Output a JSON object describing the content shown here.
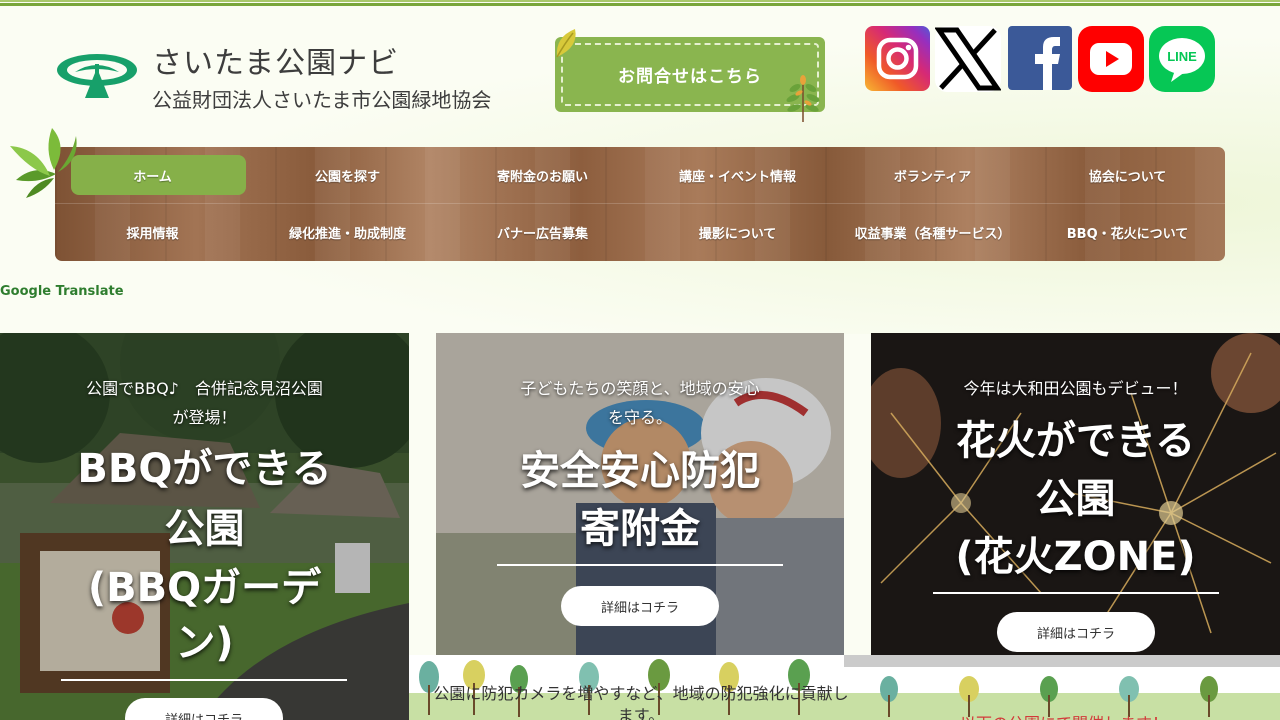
{
  "header": {
    "logo_title": "さいたま公園ナビ",
    "logo_subtitle": "公益財団法人さいたま市公園緑地協会",
    "contact_label": "お問合せはこちら"
  },
  "social": [
    {
      "name": "instagram-icon",
      "label": "Instagram"
    },
    {
      "name": "x-icon",
      "label": "X"
    },
    {
      "name": "facebook-icon",
      "label": "Facebook"
    },
    {
      "name": "youtube-icon",
      "label": "YouTube"
    },
    {
      "name": "line-icon",
      "label": "LINE"
    }
  ],
  "nav": {
    "row1": [
      "ホーム",
      "公園を探す",
      "寄附金のお願い",
      "講座・イベント情報",
      "ボランティア",
      "協会について"
    ],
    "row2": [
      "採用情報",
      "緑化推進・助成制度",
      "バナー広告募集",
      "撮影について",
      "収益事業（各種サービス）",
      "BBQ・花火について"
    ]
  },
  "google_translate": "Google Translate",
  "cards": [
    {
      "sub1": "公園でBBQ♪　合併記念見沼公園",
      "sub2": "が登場！",
      "title1": "BBQができる",
      "title2": "公園",
      "title3": "(BBQガーデ",
      "title4": "ン)",
      "button": "詳細はコチラ"
    },
    {
      "sub1": "子どもたちの笑顔と、地域の安心",
      "sub2": "を守る。",
      "title1": "安全安心防犯",
      "title2": "寄附金",
      "button": "詳細はコチラ"
    },
    {
      "sub1": "今年は大和田公園もデビュー！",
      "title1": "花火ができる",
      "title2": "公園",
      "title3": "(花火ZONE)",
      "button": "詳細はコチラ"
    }
  ],
  "strip": {
    "text": "公園に防犯カメラを増やすなど、地域の防犯強化に貢献します。",
    "text2": "以下の公園にて開催します！"
  },
  "colors": {
    "accent_green": "#8ab54f",
    "nav_wood": "#8d5e3e",
    "link_green": "#2e7d2e"
  }
}
